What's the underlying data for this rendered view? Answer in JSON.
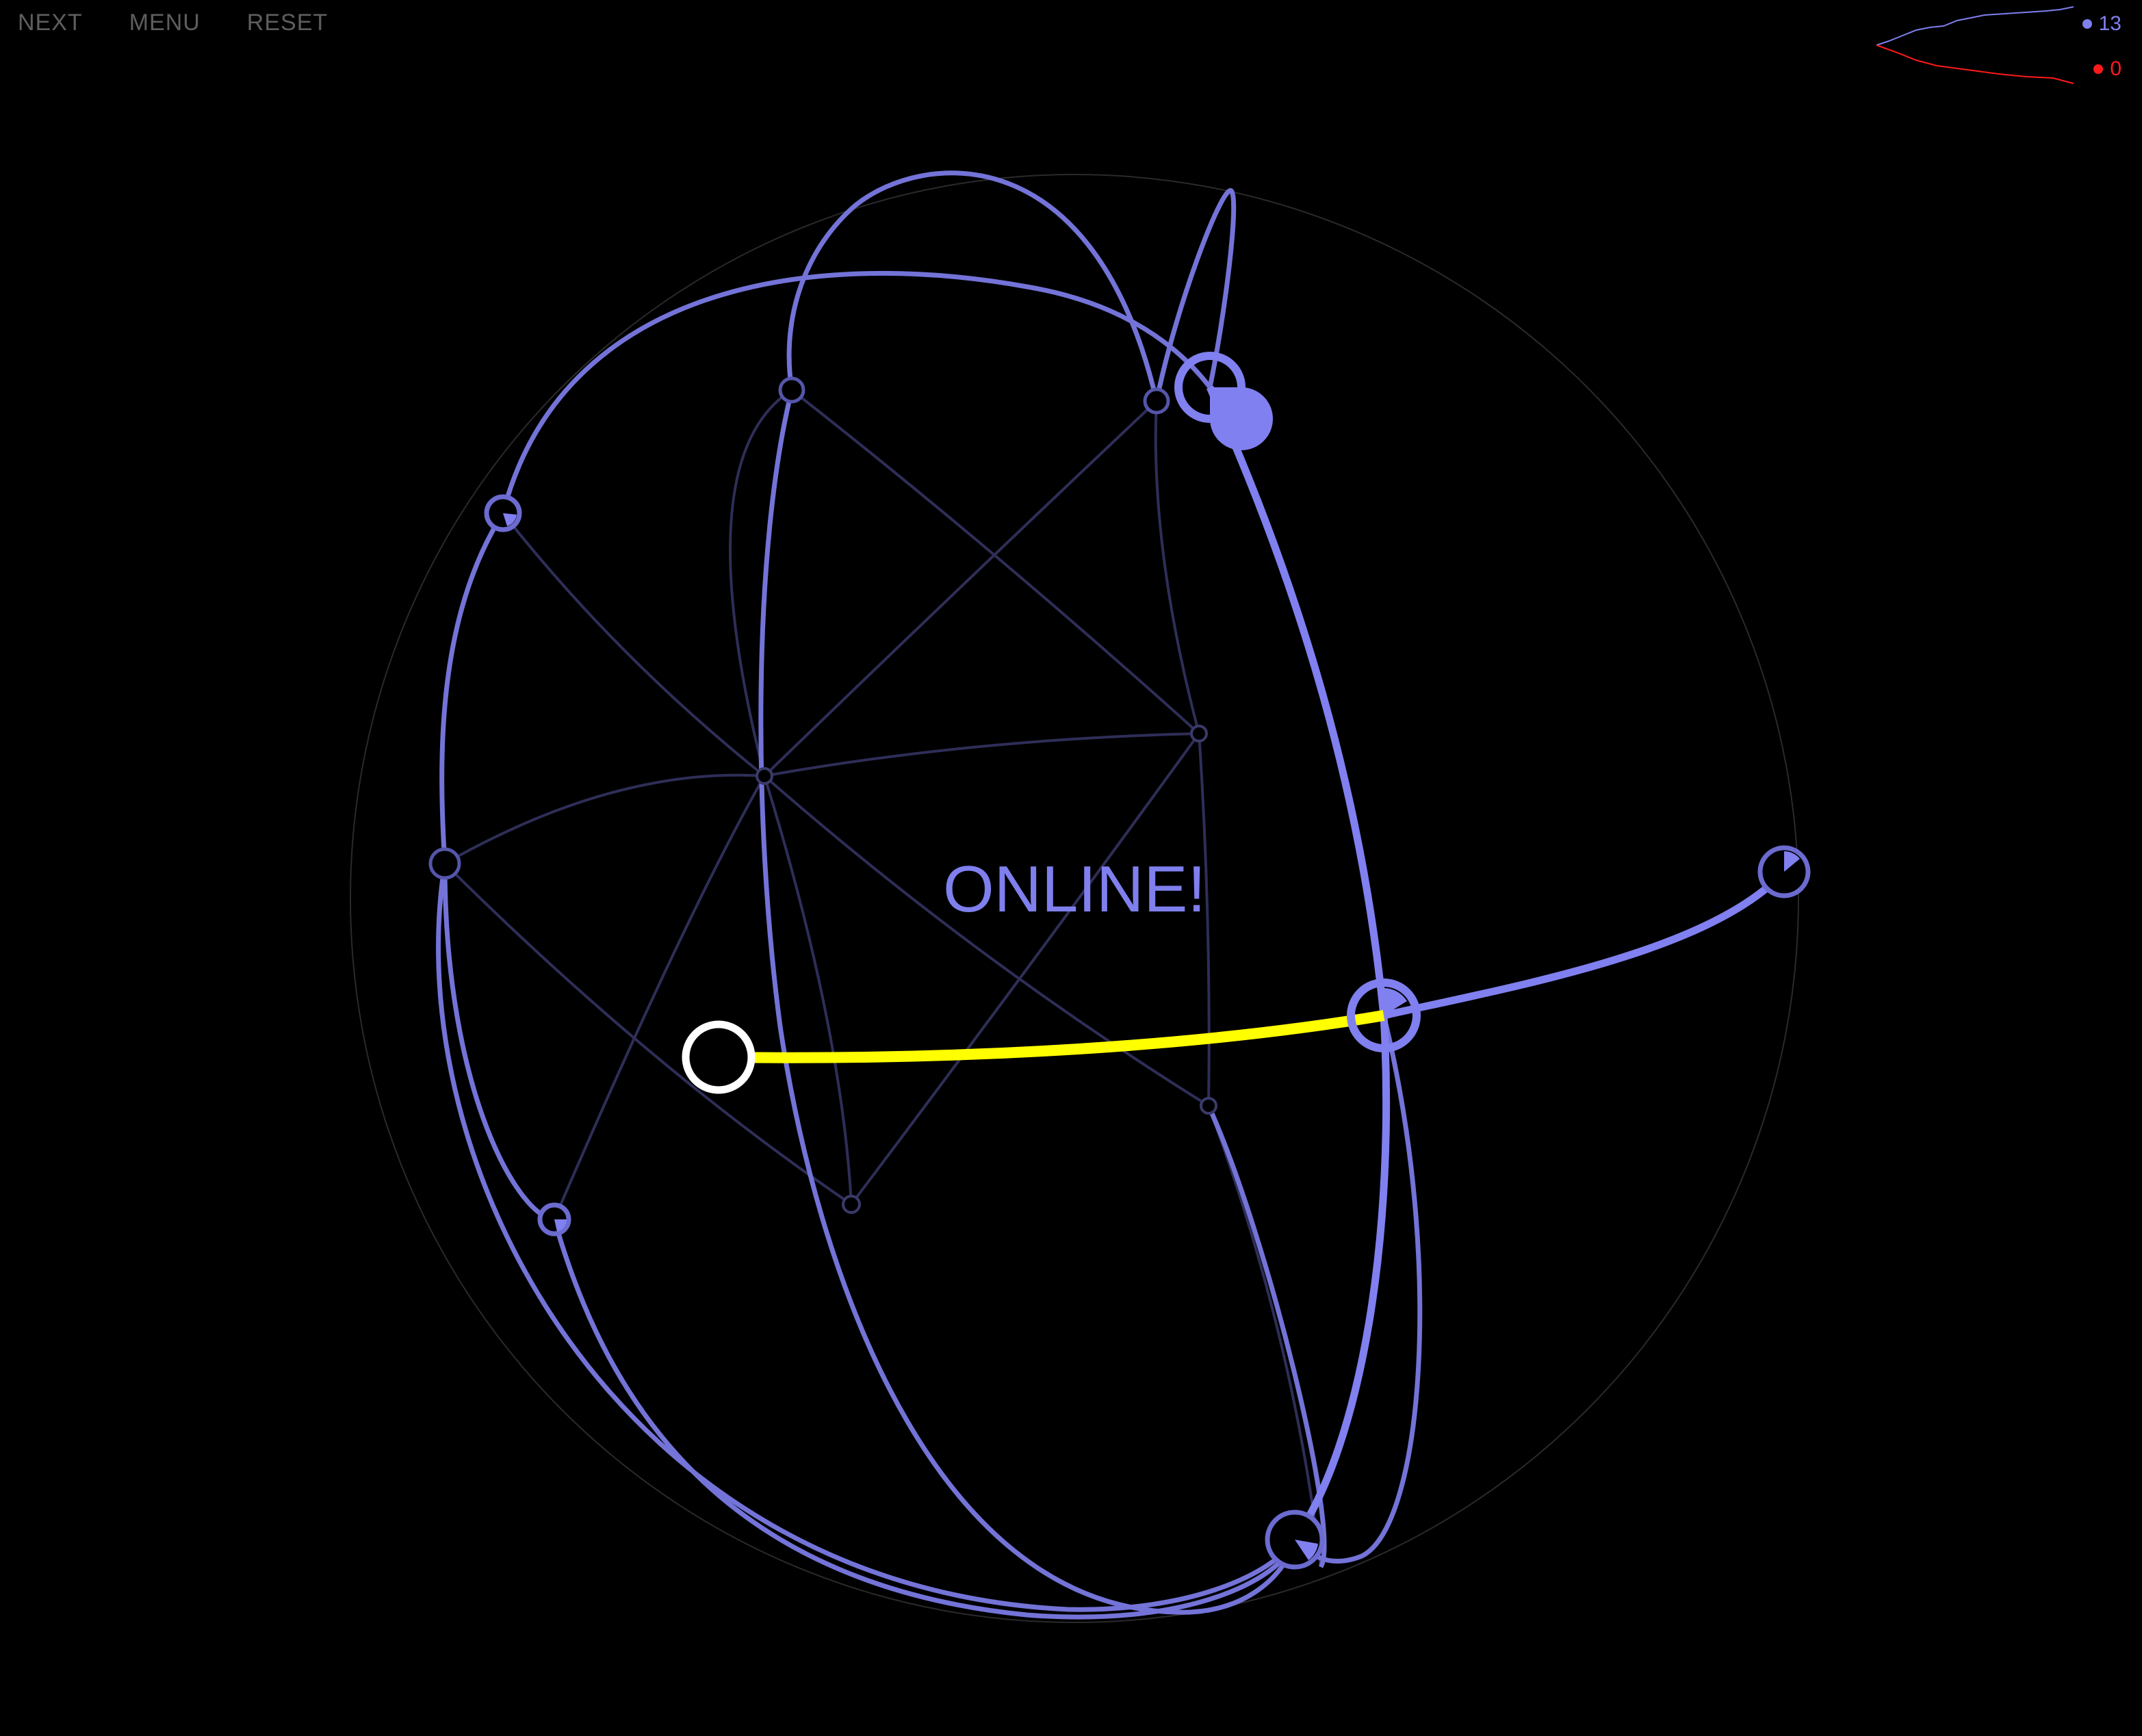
{
  "menu": {
    "next": "NEXT",
    "menu": "MENU",
    "reset": "RESET"
  },
  "score": {
    "player": "13",
    "enemy": "0",
    "player_color": "#8080ee",
    "enemy_color": "#ff1a1a"
  },
  "status": {
    "message": "ONLINE!"
  },
  "colors": {
    "link": "#7b7bec",
    "link_dim": "#2e2e58",
    "active_link": "#ffff00",
    "selected_node": "#ffffff",
    "globe_outline": "#2a2a2a"
  }
}
